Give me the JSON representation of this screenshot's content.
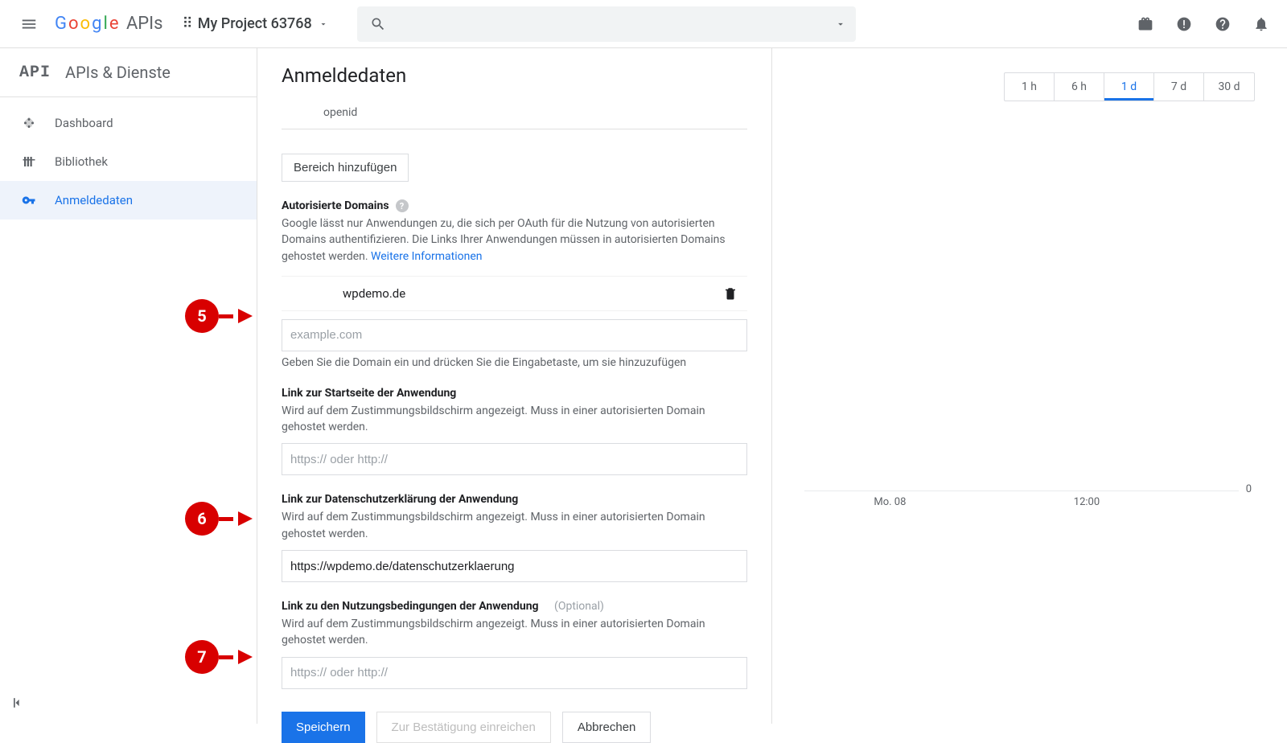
{
  "header": {
    "project_name": "My Project 63768"
  },
  "sidebar": {
    "title": "APIs & Dienste",
    "items": [
      {
        "label": "Dashboard"
      },
      {
        "label": "Bibliothek"
      },
      {
        "label": "Anmeldedaten"
      }
    ]
  },
  "page": {
    "title": "Anmeldedaten",
    "openid_label": "openid",
    "add_scope_btn": "Bereich hinzufügen",
    "auth_domains": {
      "label": "Autorisierte Domains",
      "desc": "Google lässt nur Anwendungen zu, die sich per OAuth für die Nutzung von autorisierten Domains authentifizieren. Die Links Ihrer Anwendungen müssen in autorisierten Domains gehostet werden. ",
      "more_info": "Weitere Informationen",
      "existing_domain": "wpdemo.de",
      "input_placeholder": "example.com",
      "hint": "Geben Sie die Domain ein und drücken Sie die Eingabetaste, um sie hinzuzufügen"
    },
    "homepage": {
      "label": "Link zur Startseite der Anwendung",
      "desc": "Wird auf dem Zustimmungsbildschirm angezeigt. Muss in einer autorisierten Domain gehostet werden.",
      "placeholder": "https:// oder http://",
      "value": ""
    },
    "privacy": {
      "label": "Link zur Datenschutzerklärung der Anwendung",
      "desc": "Wird auf dem Zustimmungsbildschirm angezeigt. Muss in einer autorisierten Domain gehostet werden.",
      "value": "https://wpdemo.de/datenschutzerklaerung"
    },
    "tos": {
      "label": "Link zu den Nutzungsbedingungen der Anwendung",
      "optional": "(Optional)",
      "desc": "Wird auf dem Zustimmungsbildschirm angezeigt. Muss in einer autorisierten Domain gehostet werden.",
      "placeholder": "https:// oder http://",
      "value": ""
    },
    "actions": {
      "save": "Speichern",
      "submit_verify": "Zur Bestätigung einreichen",
      "cancel": "Abbrechen"
    }
  },
  "time_tabs": [
    "1 h",
    "6 h",
    "1 d",
    "7 d",
    "30 d"
  ],
  "chart_data": {
    "type": "line",
    "title": "",
    "series": [],
    "x_ticks": [
      "Mo. 08",
      "12:00"
    ],
    "ylim": [
      0,
      0
    ],
    "ylabel": "",
    "axis_zero": "0"
  },
  "markers": {
    "5": "5",
    "6": "6",
    "7": "7"
  }
}
